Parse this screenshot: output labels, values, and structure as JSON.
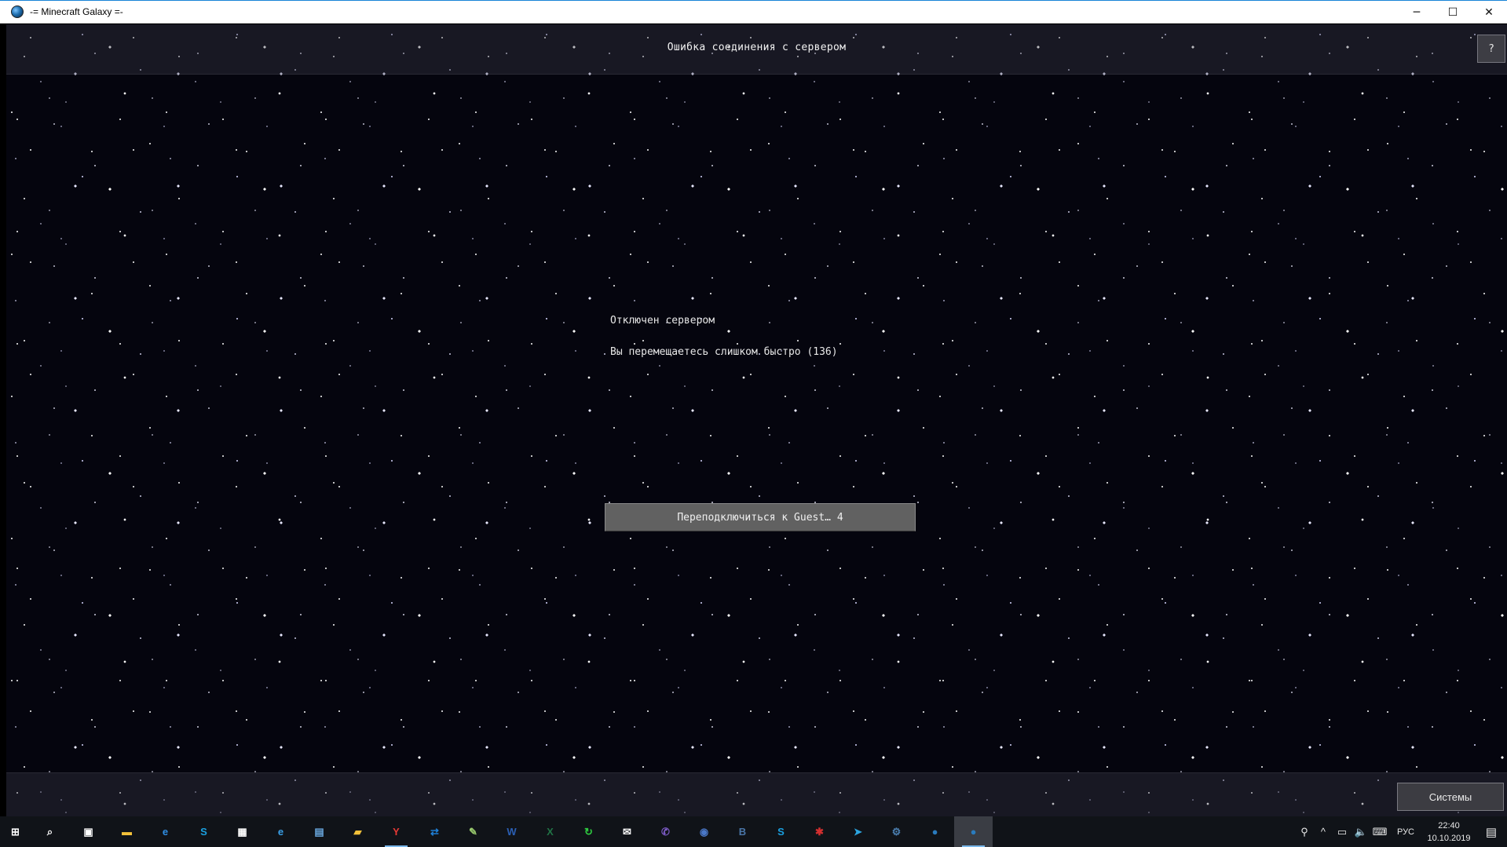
{
  "window": {
    "title": "-= Minecraft Galaxy =-",
    "controls": {
      "minimize": "─",
      "maximize": "☐",
      "close": "✕"
    }
  },
  "game": {
    "header_title": "Ошибка соединения с сервером",
    "help_label": "?",
    "message_title": "Отключен сервером",
    "message_detail": "Вы перемещаетесь слишком быстро (136)",
    "reconnect_label": "Переподключиться к Guest… 4",
    "systems_label": "Системы"
  },
  "taskbar": {
    "items": [
      {
        "name": "start-icon",
        "glyph": "⊞",
        "color": "#ffffff"
      },
      {
        "name": "search-icon",
        "glyph": "⌕",
        "color": "#ffffff"
      },
      {
        "name": "task-view-icon",
        "glyph": "▣",
        "color": "#ffffff"
      },
      {
        "name": "file-explorer-icon",
        "glyph": "▬",
        "color": "#f3c13a"
      },
      {
        "name": "edge-icon",
        "glyph": "e",
        "color": "#2f8fe6"
      },
      {
        "name": "skype-icon",
        "glyph": "S",
        "color": "#1aa0e0"
      },
      {
        "name": "store-icon",
        "glyph": "▦",
        "color": "#ffffff"
      },
      {
        "name": "ie-icon",
        "glyph": "e",
        "color": "#3aa0e8"
      },
      {
        "name": "control-panel-icon",
        "glyph": "▤",
        "color": "#6aa9e0"
      },
      {
        "name": "folder-icon",
        "glyph": "▰",
        "color": "#f3c13a"
      },
      {
        "name": "yandex-browser-icon",
        "glyph": "Y",
        "color": "#e53935"
      },
      {
        "name": "teamviewer-icon",
        "glyph": "⇄",
        "color": "#1f7fd6"
      },
      {
        "name": "paint-icon",
        "glyph": "✎",
        "color": "#9acb6e"
      },
      {
        "name": "word-icon",
        "glyph": "W",
        "color": "#2b5fb4"
      },
      {
        "name": "excel-icon",
        "glyph": "X",
        "color": "#207245"
      },
      {
        "name": "refresh-app-icon",
        "glyph": "↻",
        "color": "#2ecc40"
      },
      {
        "name": "mail-icon",
        "glyph": "✉",
        "color": "#ffffff"
      },
      {
        "name": "viber-icon",
        "glyph": "✆",
        "color": "#7d5cc7"
      },
      {
        "name": "media-app-icon",
        "glyph": "◉",
        "color": "#4a78c8"
      },
      {
        "name": "vk-icon",
        "glyph": "В",
        "color": "#4a76a8"
      },
      {
        "name": "skype-2-icon",
        "glyph": "S",
        "color": "#1aa0e0"
      },
      {
        "name": "antivirus-icon",
        "glyph": "✱",
        "color": "#d32f2f"
      },
      {
        "name": "telegram-icon",
        "glyph": "➤",
        "color": "#2ca5e0"
      },
      {
        "name": "steam-icon",
        "glyph": "⚙",
        "color": "#4b7fb0"
      },
      {
        "name": "minecraft-galaxy-icon",
        "glyph": "●",
        "color": "#2a7bbd"
      },
      {
        "name": "minecraft-galaxy-active-icon",
        "glyph": "●",
        "color": "#2a7bbd"
      }
    ],
    "tray": {
      "people_icon": "⚲",
      "chevron_icon": "^",
      "network_icon": "▭",
      "volume_icon": "🔈",
      "keyboard_icon": "⌨",
      "language": "РУС",
      "time": "22:40",
      "date": "10.10.2019",
      "notifications_icon": "▤"
    }
  }
}
